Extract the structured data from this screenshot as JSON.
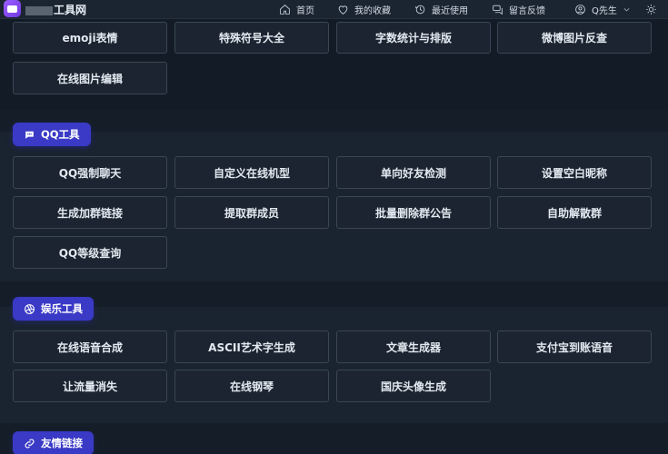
{
  "header": {
    "site_name_suffix": "工具网",
    "nav": [
      {
        "label": "首页",
        "icon": "home-icon"
      },
      {
        "label": "我的收藏",
        "icon": "heart-icon"
      },
      {
        "label": "最近使用",
        "icon": "history-icon"
      },
      {
        "label": "留言反馈",
        "icon": "message-icon"
      },
      {
        "label": "Q先生",
        "icon": "user-icon"
      }
    ],
    "theme_icon": "sun-icon",
    "accent": "#6e6bff"
  },
  "sections": {
    "top": {
      "tools": [
        "emoji表情",
        "特殊符号大全",
        "字数统计与排版",
        "微博图片反查",
        "在线图片编辑"
      ]
    },
    "qq": {
      "title": "QQ工具",
      "icon": "chat-bubble-icon",
      "tools": [
        "QQ强制聊天",
        "自定义在线机型",
        "单向好友检测",
        "设置空白昵称",
        "生成加群链接",
        "提取群成员",
        "批量删除群公告",
        "自助解散群",
        "QQ等级查询"
      ]
    },
    "entertainment": {
      "title": "娱乐工具",
      "icon": "aperture-icon",
      "tools": [
        "在线语音合成",
        "ASCII艺术字生成",
        "文章生成器",
        "支付宝到账语音",
        "让流量消失",
        "在线钢琴",
        "国庆头像生成"
      ]
    },
    "links": {
      "title": "友情链接",
      "icon": "link-icon"
    }
  },
  "colors": {
    "chip": "#3a3ac6",
    "background": "#15202b"
  }
}
